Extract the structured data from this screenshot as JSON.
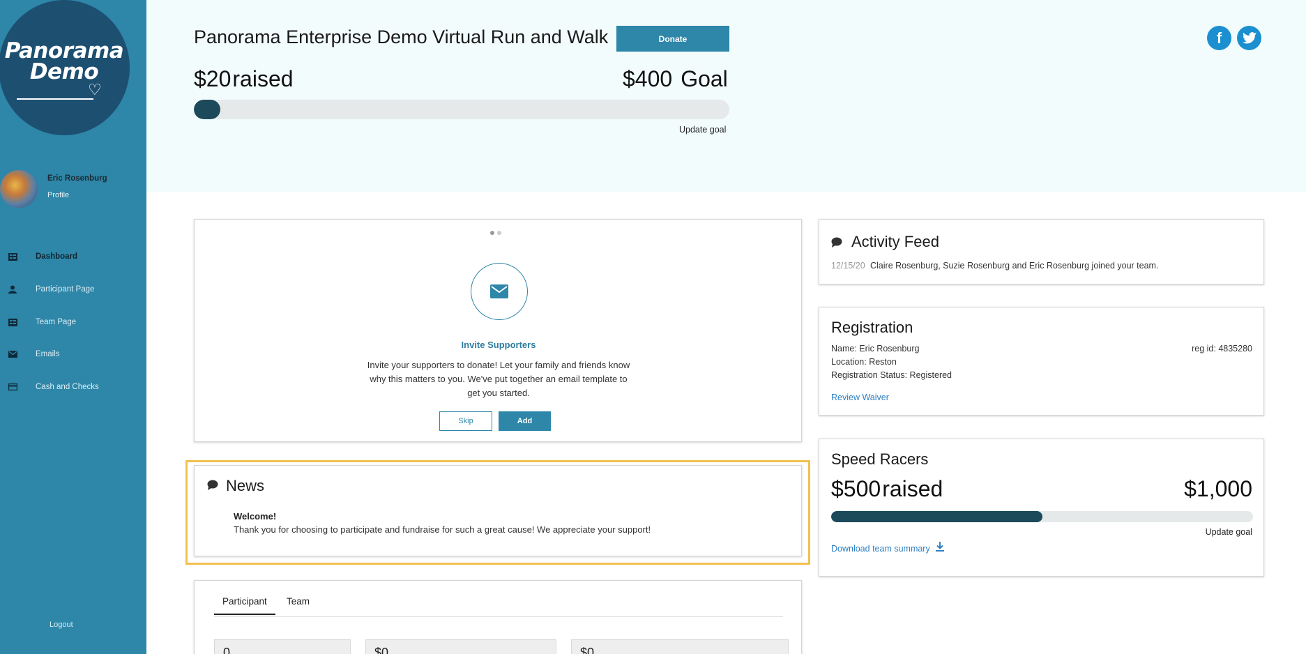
{
  "brand": {
    "logo_line1": "Panorama",
    "logo_line2": "Demo",
    "accent": "#2e86a8",
    "dark": "#1c4a5a",
    "highlight": "#f2c14e"
  },
  "profile": {
    "name": "Eric Rosenburg",
    "link": "Profile"
  },
  "nav": {
    "items": [
      {
        "label": "Dashboard",
        "icon": "dashboard-icon"
      },
      {
        "label": "Participant Page",
        "icon": "person-icon"
      },
      {
        "label": "Team Page",
        "icon": "team-icon"
      },
      {
        "label": "Emails",
        "icon": "mail-icon"
      },
      {
        "label": "Cash and Checks",
        "icon": "card-icon"
      }
    ],
    "logout": "Logout"
  },
  "header": {
    "title": "Panorama Enterprise Demo Virtual Run and Walk",
    "donate": "Donate",
    "raised_amount": "$20",
    "raised_word": "raised",
    "goal_amount": "$400",
    "goal_word": "Goal",
    "progress_fraction": 0.05,
    "update_goal": "Update goal",
    "social": [
      "facebook-icon",
      "twitter-icon"
    ]
  },
  "invite": {
    "title": "Invite Supporters",
    "body": "Invite your supporters to donate! Let your family and friends know why this matters to you. We've put together an email template to get you started.",
    "skip": "Skip",
    "add": "Add"
  },
  "news": {
    "title": "News",
    "welcome": "Welcome!",
    "body": "Thank you for choosing to participate and fundraise for such a great cause! We appreciate your support!"
  },
  "tabs": {
    "participant": "Participant",
    "team": "Team",
    "stats": [
      "0",
      "$0",
      "$0"
    ]
  },
  "activity": {
    "title": "Activity Feed",
    "date": "12/15/20",
    "text": "Claire Rosenburg, Suzie Rosenburg and Eric Rosenburg joined your team."
  },
  "registration": {
    "title": "Registration",
    "name": "Name: Eric Rosenburg",
    "location": "Location: Reston",
    "status": "Registration Status: Registered",
    "reg_id": "reg id: 4835280",
    "waiver": "Review Waiver"
  },
  "team": {
    "name": "Speed Racers",
    "raised_amount": "$500",
    "raised_word": "raised",
    "goal_amount": "$1,000",
    "progress_fraction": 0.5,
    "update_goal": "Update goal",
    "download": "Download team summary"
  }
}
